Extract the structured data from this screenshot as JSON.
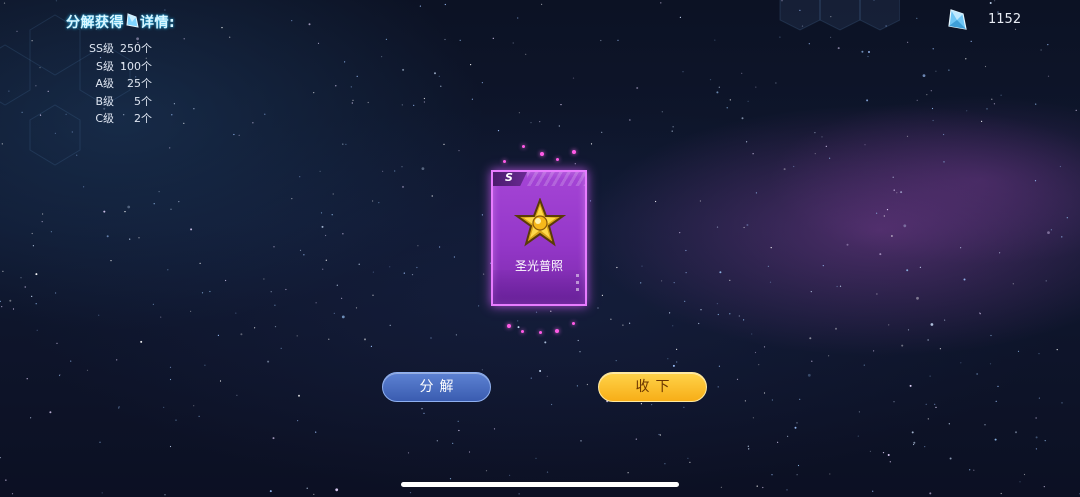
{
  "info_panel": {
    "title_before": "分解获得",
    "title_after": "详情:",
    "rows": [
      {
        "grade": "SS级",
        "amount": "250个"
      },
      {
        "grade": "S级",
        "amount": "100个"
      },
      {
        "grade": "A级",
        "amount": "25个"
      },
      {
        "grade": "B级",
        "amount": "5个"
      },
      {
        "grade": "C级",
        "amount": "2个"
      }
    ]
  },
  "currency": {
    "icon": "crystal-diamond-icon",
    "value": "1152"
  },
  "card": {
    "rank": "S",
    "name": "圣光普照",
    "emblem": "golden-star-emblem-icon"
  },
  "buttons": {
    "decompose": "分解",
    "collect": "收下"
  },
  "colors": {
    "card_purple": "#9437c8",
    "card_border": "#e87cff",
    "decompose_blue": "#3a5cb0",
    "collect_yellow": "#f7ae17"
  }
}
